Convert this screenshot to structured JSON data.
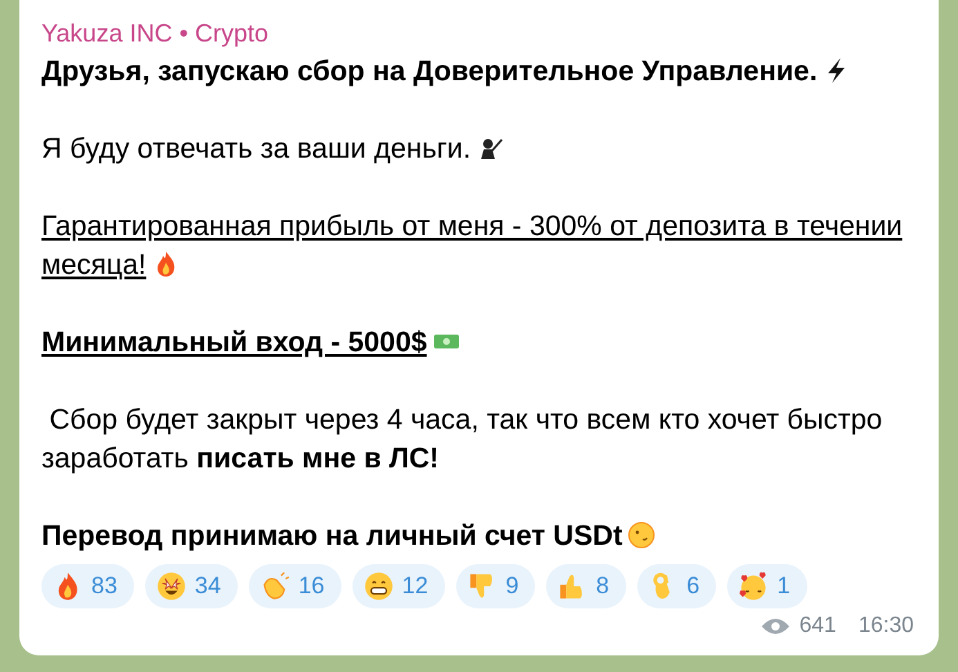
{
  "message": {
    "author": "Yakuza INC • Crypto",
    "paragraphs": [
      {
        "lines": [
          "Друзья, запускаю сбор на Доверительное Управление."
        ]
      },
      {
        "lines": [
          "Я буду отвечать за ваши деньги."
        ]
      },
      {
        "lines": [
          "Гарантированная прибыль от меня - 300% от депозита в течении",
          "месяца!"
        ]
      },
      {
        "lines": [
          "Минимальный вход - 5000$"
        ]
      },
      {
        "lines": [
          " Сбор будет закрыт через 4 часа, так что всем кто хочет быстро",
          "заработать **писать мне в ЛС!**"
        ]
      },
      {
        "lines": [
          "Перевод принимаю на личный счет USDt"
        ]
      }
    ],
    "reactions": [
      {
        "count": "83"
      },
      {
        "count": "34"
      },
      {
        "count": "16"
      },
      {
        "count": "12"
      },
      {
        "count": "9"
      },
      {
        "count": "8"
      },
      {
        "count": "6"
      },
      {
        "count": "1"
      }
    ],
    "views": "641",
    "time": "16:30"
  }
}
